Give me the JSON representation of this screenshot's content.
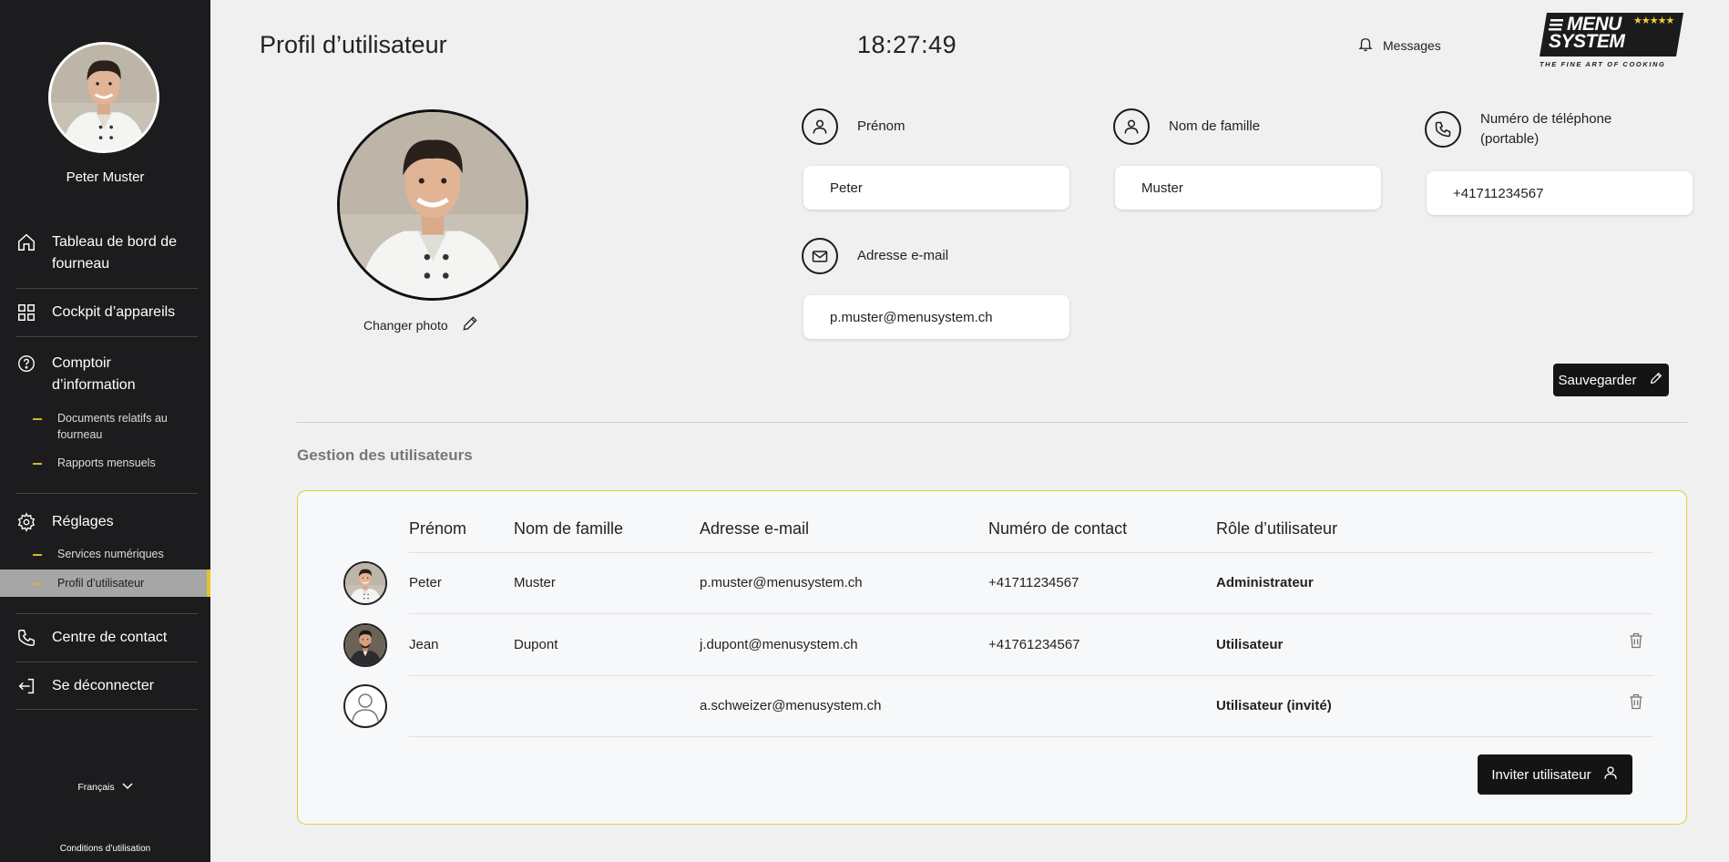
{
  "user": {
    "name": "Peter Muster"
  },
  "sidebar": {
    "items": [
      {
        "label": "Tableau de bord de fourneau",
        "icon": "home-icon"
      },
      {
        "label": "Cockpit d’appareils",
        "icon": "grid-icon"
      },
      {
        "label": "Comptoir d’information",
        "icon": "help-circle-icon",
        "subitems": [
          "Documents relatifs au fourneau",
          "Rapports mensuels"
        ]
      },
      {
        "label": "Réglages",
        "icon": "gear-icon",
        "subitems": [
          "Services numériques",
          "Profil d’utilisateur"
        ]
      },
      {
        "label": "Centre de contact",
        "icon": "phone-icon"
      },
      {
        "label": "Se déconnecter",
        "icon": "logout-icon"
      }
    ],
    "language": "Français",
    "terms": "Conditions d’utilisation"
  },
  "header": {
    "title": "Profil d’utilisateur",
    "clock": "18:27:49",
    "messages": "Messages",
    "logo": {
      "line1": "MENU",
      "line2": "SYSTEM",
      "stars": "★★★★★",
      "tagline": "THE FINE ART OF COOKING"
    }
  },
  "profile": {
    "change_photo": "Changer photo",
    "first_name_label": "Prénom",
    "first_name": "Peter",
    "last_name_label": "Nom de famille",
    "last_name": "Muster",
    "phone_label_1": "Numéro de téléphone",
    "phone_label_2": "(portable)",
    "phone": "+41711234567",
    "email_label": "Adresse e-mail",
    "email": "p.muster@menusystem.ch",
    "save": "Sauvegarder"
  },
  "users": {
    "section_title": "Gestion des utilisateurs",
    "columns": [
      "Prénom",
      "Nom de famille",
      "Adresse e-mail",
      "Numéro de contact",
      "Rôle d’utilisateur"
    ],
    "rows": [
      {
        "first": "Peter",
        "last": "Muster",
        "email": "p.muster@menusystem.ch",
        "phone": "+41711234567",
        "role": "Administrateur"
      },
      {
        "first": "Jean",
        "last": "Dupont",
        "email": "j.dupont@menusystem.ch",
        "phone": "+41761234567",
        "role": "Utilisateur"
      },
      {
        "first": "",
        "last": "",
        "email": "a.schweizer@menusystem.ch",
        "phone": "",
        "role": "Utilisateur (invité)"
      }
    ],
    "invite": "Inviter utilisateur"
  },
  "colors": {
    "sidebar_bg": "#1c1c1e",
    "accent": "#e0c428",
    "button_bg": "#141414",
    "page_bg": "#f0f0f0"
  }
}
